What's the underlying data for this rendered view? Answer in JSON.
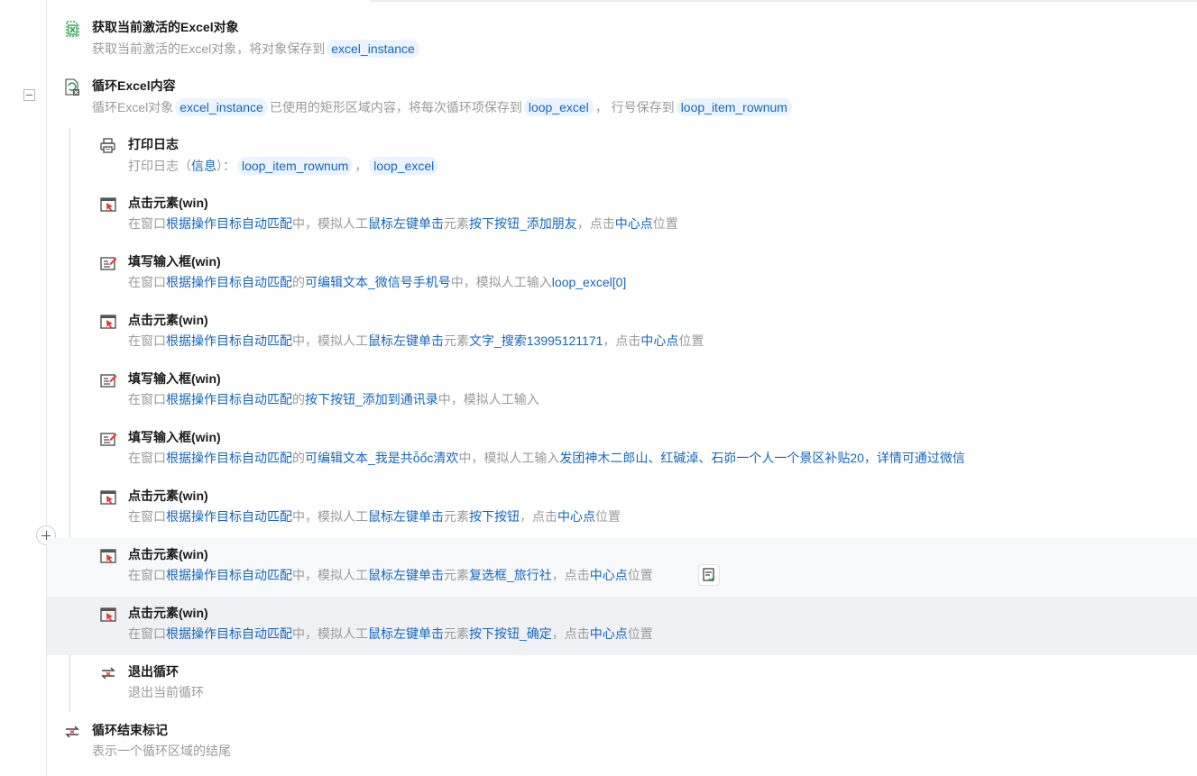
{
  "steps": {
    "s1": {
      "title": "获取当前激活的Excel对象",
      "desc_prefix": "获取当前激活的Excel对象，将对象保存到",
      "var": "excel_instance"
    },
    "s2": {
      "title": "循环Excel内容",
      "d1": "循环Excel对象",
      "var1": "excel_instance",
      "d2": "已使用的矩形区域内容，将每次循环项保存到",
      "var2": "loop_excel",
      "d3": "， 行号保存到",
      "var3": "loop_item_rownum"
    },
    "s3": {
      "title": "打印日志",
      "d1": "打印日志（",
      "level": "信息",
      "d2": "）：",
      "var1": "loop_item_rownum",
      "comma": "，",
      "var2": "loop_excel"
    },
    "s4": {
      "title": "点击元素(win)",
      "d1": "在窗口",
      "w1": "根据操作目标自动匹配",
      "d2": "中，模拟人工",
      "w2": "鼠标左键单击",
      "d3": "元素",
      "w3": "按下按钮_添加朋友",
      "d4": "，点击",
      "w4": "中心点",
      "d5": "位置"
    },
    "s5": {
      "title": "填写输入框(win)",
      "d1": "在窗口",
      "w1": "根据操作目标自动匹配",
      "d2": "的",
      "w2": "可编辑文本_微信号手机号",
      "d3": "中，模拟人工输入",
      "w3": "loop_excel[0]"
    },
    "s6": {
      "title": "点击元素(win)",
      "d1": "在窗口",
      "w1": "根据操作目标自动匹配",
      "d2": "中，模拟人工",
      "w2": "鼠标左键单击",
      "d3": "元素",
      "w3": "文字_搜索13995121171",
      "d4": "，点击",
      "w4": "中心点",
      "d5": "位置"
    },
    "s7": {
      "title": "填写输入框(win)",
      "d1": "在窗口",
      "w1": "根据操作目标自动匹配",
      "d2": "的",
      "w2": "按下按钮_添加到通讯录",
      "d3": "中，模拟人工输入"
    },
    "s8": {
      "title": "填写输入框(win)",
      "d1": "在窗口",
      "w1": "根据操作目标自动匹配",
      "d2": "的",
      "w2": "可编辑文本_我是共ỗổc清欢",
      "d3": "中，模拟人工输入",
      "w3": "发团神木二郎山、红碱淖、石峁一个人一个景区补贴20，详情可通过微信"
    },
    "s9": {
      "title": "点击元素(win)",
      "d1": "在窗口",
      "w1": "根据操作目标自动匹配",
      "d2": "中，模拟人工",
      "w2": "鼠标左键单击",
      "d3": "元素",
      "w3": "按下按钮",
      "d4": "，点击",
      "w4": "中心点",
      "d5": "位置"
    },
    "s10": {
      "title": "点击元素(win)",
      "d1": "在窗口",
      "w1": "根据操作目标自动匹配",
      "d2": "中，模拟人工",
      "w2": "鼠标左键单击",
      "d3": "元素",
      "w3": "复选框_旅行社",
      "d4": "，点击",
      "w4": "中心点",
      "d5": "位置"
    },
    "s11": {
      "title": "点击元素(win)",
      "d1": "在窗口",
      "w1": "根据操作目标自动匹配",
      "d2": "中，模拟人工",
      "w2": "鼠标左键单击",
      "d3": "元素",
      "w3": "按下按钮_确定",
      "d4": "，点击",
      "w4": "中心点",
      "d5": "位置"
    },
    "s12": {
      "title": "退出循环",
      "desc": "退出当前循环"
    },
    "s13": {
      "title": "循环结束标记",
      "desc": "表示一个循环区域的结尾"
    }
  },
  "colors": {
    "link": "#1565c0",
    "muted": "#9a9a9a",
    "tag_bg": "#eaf3ff",
    "selected_row": "#f0f1f4"
  },
  "icons": [
    "excel-icon",
    "excel-loop-icon",
    "printer-icon",
    "click-element-icon",
    "fill-input-icon",
    "exit-loop-icon",
    "loop-end-icon",
    "plus-icon",
    "collapse-icon",
    "checklist-icon"
  ]
}
